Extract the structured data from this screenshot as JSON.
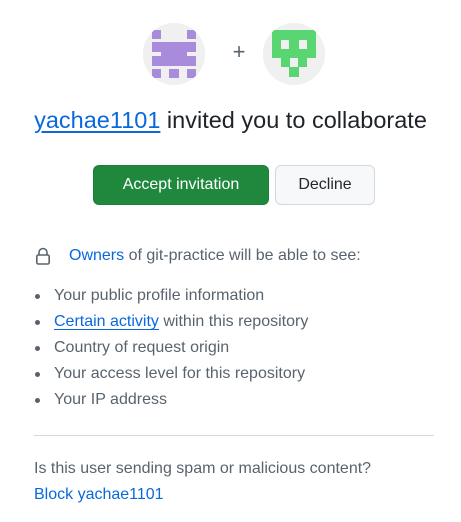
{
  "invite": {
    "inviter": "yachae1101",
    "headline_rest": " invited you to collaborate",
    "plus": "+",
    "inviter_avatar_color": "#a98bdc",
    "repo_avatar_color": "#59d672"
  },
  "actions": {
    "accept_label": "Accept invitation",
    "decline_label": "Decline",
    "accept_color": "#1f883d"
  },
  "permissions": {
    "owners_link": "Owners",
    "intro_rest": " of git-practice will be able to see:",
    "items": [
      {
        "text": "Your public profile information"
      },
      {
        "link": "Certain activity",
        "text": " within this repository"
      },
      {
        "text": "Country of request origin"
      },
      {
        "text": "Your access level for this repository"
      },
      {
        "text": "Your IP address"
      }
    ]
  },
  "footer": {
    "spam_question": "Is this user sending spam or malicious content?",
    "block_link": "Block yachae1101"
  },
  "colors": {
    "link": "#0969da",
    "muted_text": "#59636e"
  }
}
